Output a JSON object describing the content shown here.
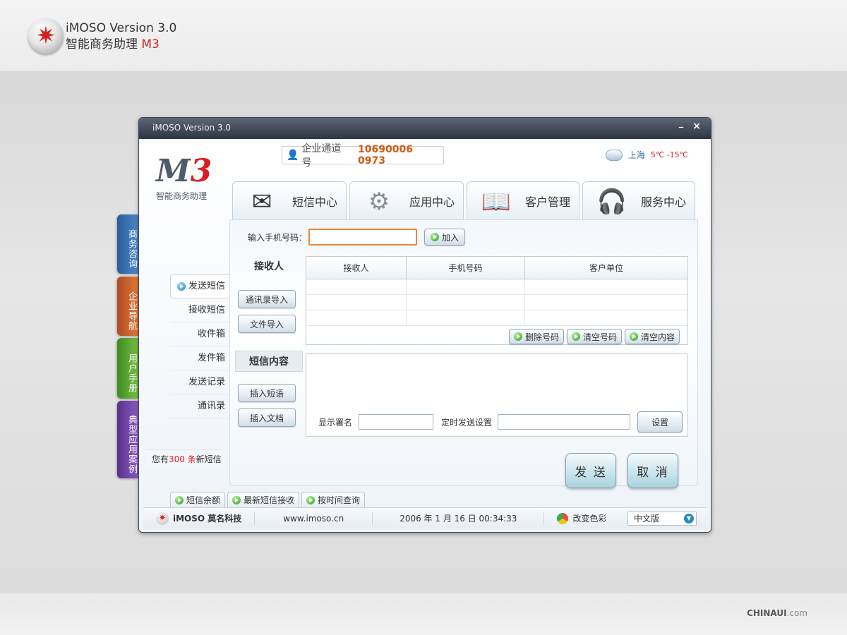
{
  "brand": {
    "version": "iMOSO Version 3.0",
    "name": "智能商务助理",
    "m3": "M3"
  },
  "window": {
    "title": "iMOSO Version 3.0",
    "min_label": "–",
    "close_label": "×"
  },
  "side_tabs": [
    "商务咨询",
    "企业导航",
    "用户手册",
    "典型应用案例"
  ],
  "header": {
    "logo_m": "M",
    "logo_3": "3",
    "logo_sub": "智能商务助理",
    "channel_label": "企业通道号",
    "channel_number": "10690006 0973",
    "city": "上海",
    "temp": "5℃ -15℃"
  },
  "main_tabs": [
    {
      "label": "短信中心",
      "icon": "envelope-icon"
    },
    {
      "label": "应用中心",
      "icon": "gears-icon"
    },
    {
      "label": "客户管理",
      "icon": "book-icon"
    },
    {
      "label": "服务中心",
      "icon": "headset-agent-icon"
    }
  ],
  "sidenav": [
    "发送短信",
    "接收短信",
    "收件箱",
    "发件箱",
    "发送记录",
    "通讯录"
  ],
  "new_msg": {
    "prefix": "您有",
    "count": "300 条",
    "suffix": "新短信"
  },
  "form": {
    "phone_label": "输入手机号码：",
    "add_label": "加入",
    "receiver_section": "接收人",
    "import_contacts": "通讯录导入",
    "import_file": "文件导入",
    "table_headers": [
      "接收人",
      "手机号码",
      "客户单位"
    ],
    "delete_numbers": "删除号码",
    "clear_numbers": "清空号码",
    "clear_content": "清空内容",
    "content_section": "短信内容",
    "insert_phrase": "插入短语",
    "insert_doc": "插入文档",
    "signature_label": "显示署名",
    "schedule_label": "定时发送设置",
    "settings_label": "设置",
    "send_label": "发 送",
    "cancel_label": "取 消"
  },
  "bottom_tabs": [
    "短信余额",
    "最新短信接收",
    "按时间查询"
  ],
  "status": {
    "company": "iMOSO 莫名科技",
    "site": "www.imoso.cn",
    "datetime": "2006 年 1 月 16 日  00:34:33",
    "change_color": "改变色彩",
    "language": "中文版"
  },
  "watermark": {
    "main": "CHINAUI",
    "suffix": ".com"
  },
  "colors": {
    "accent_red": "#d81e1e",
    "channel_number": "#d05a10",
    "input_focus": "#e8893a"
  }
}
